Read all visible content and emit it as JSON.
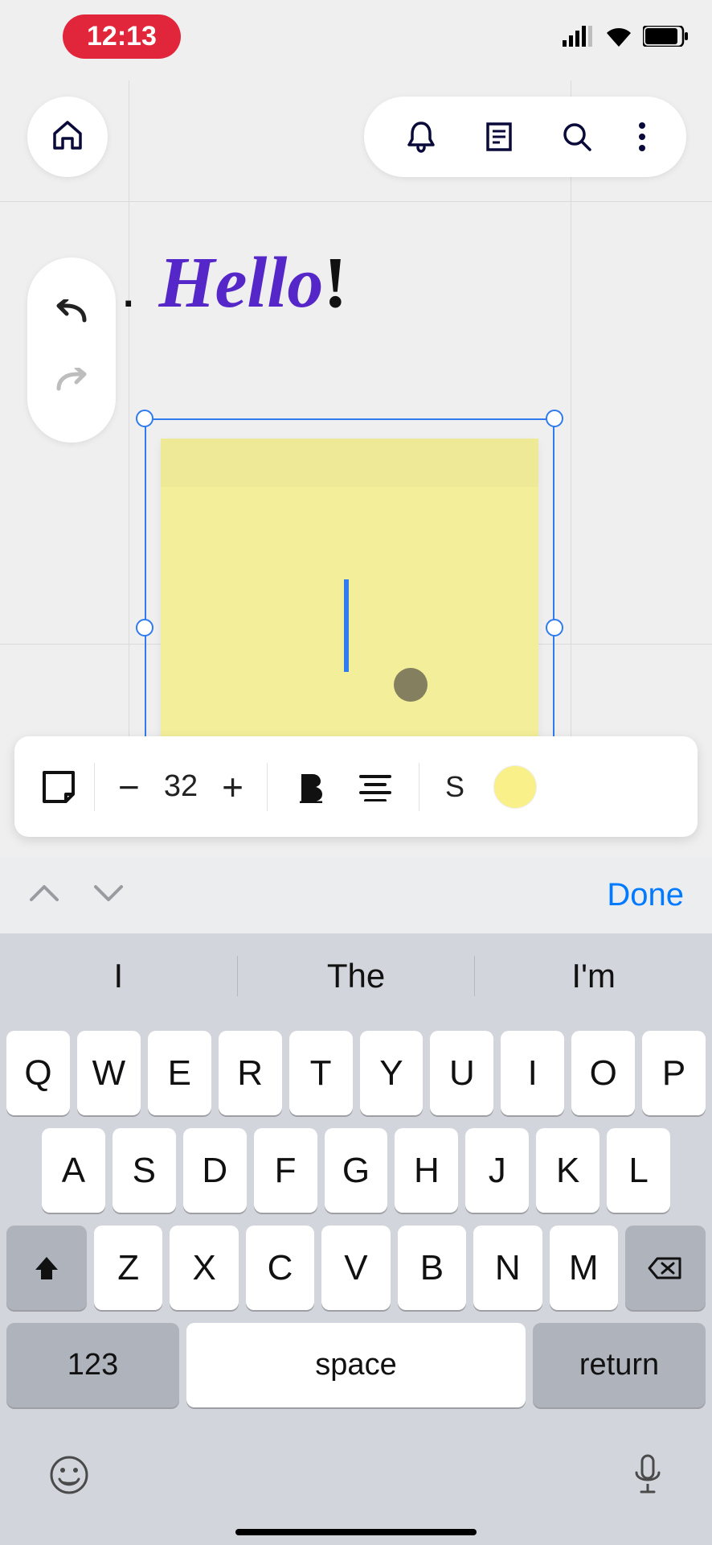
{
  "status": {
    "time": "12:13"
  },
  "canvas": {
    "title_hello": "Hello",
    "title_excl": "!",
    "title_bullet": "."
  },
  "format_bar": {
    "font_size": "32",
    "size_label": "S"
  },
  "kb_accessory": {
    "done": "Done"
  },
  "keyboard": {
    "suggestions": [
      "I",
      "The",
      "I'm"
    ],
    "row1": [
      "Q",
      "W",
      "E",
      "R",
      "T",
      "Y",
      "U",
      "I",
      "O",
      "P"
    ],
    "row2": [
      "A",
      "S",
      "D",
      "F",
      "G",
      "H",
      "J",
      "K",
      "L"
    ],
    "row3": [
      "Z",
      "X",
      "C",
      "V",
      "B",
      "N",
      "M"
    ],
    "key_123": "123",
    "key_space": "space",
    "key_return": "return"
  }
}
